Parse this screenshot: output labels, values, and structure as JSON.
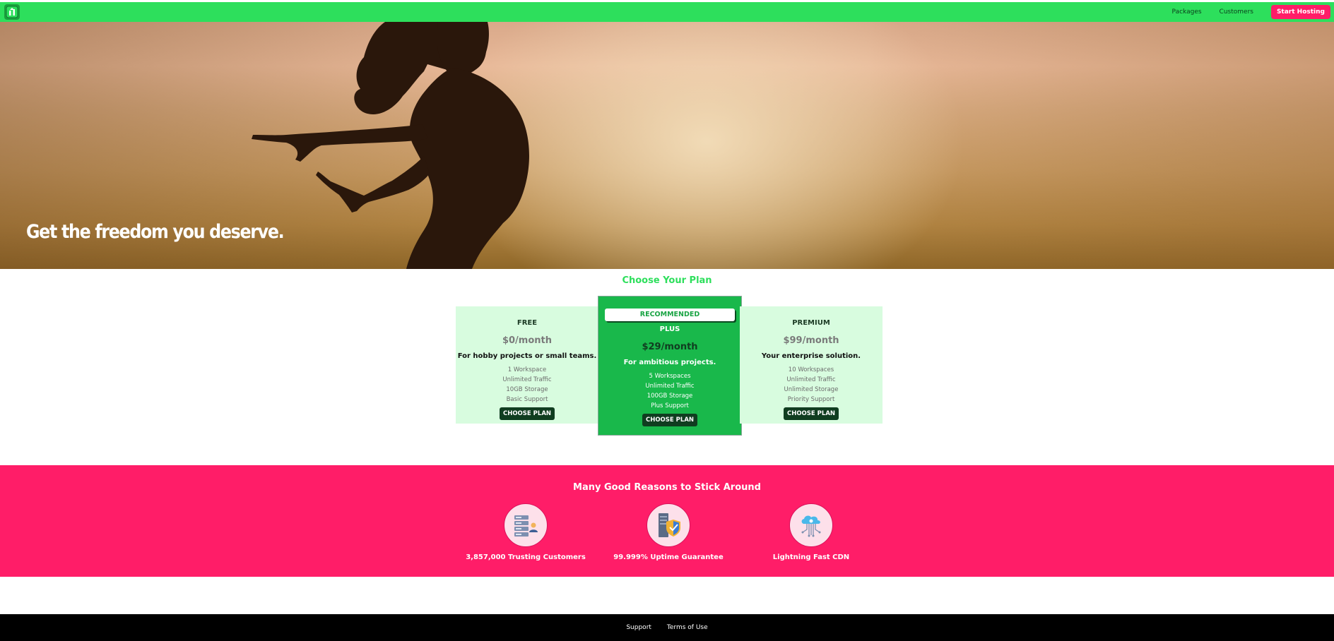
{
  "header": {
    "logo_icon": "hosting-logo-icon",
    "nav": [
      {
        "label": "Packages"
      },
      {
        "label": "Customers"
      }
    ],
    "cta_label": "Start Hosting",
    "accent_color": "#2ddf5c",
    "cta_color": "#ff1d68"
  },
  "hero": {
    "title": "Get the freedom you deserve."
  },
  "plans": {
    "title": "Choose Your Plan",
    "items": [
      {
        "name": "FREE",
        "price": "$0/month",
        "description": "For hobby projects or small teams.",
        "features": [
          "1 Workspace",
          "Unlimited Traffic",
          "10GB Storage",
          "Basic Support"
        ],
        "button": "CHOOSE PLAN"
      },
      {
        "badge": "RECOMMENDED",
        "name": "PLUS",
        "price": "$29/month",
        "description": "For ambitious projects.",
        "features": [
          "5 Workspaces",
          "Unlimited Traffic",
          "100GB Storage",
          "Plus Support"
        ],
        "button": "CHOOSE PLAN"
      },
      {
        "name": "PREMIUM",
        "price": "$99/month",
        "description": "Your enterprise solution.",
        "features": [
          "10 Workspaces",
          "Unlimited Traffic",
          "Unlimited Storage",
          "Priority Support"
        ],
        "button": "CHOOSE PLAN"
      }
    ]
  },
  "reasons": {
    "title": "Many Good Reasons to Stick Around",
    "items": [
      {
        "icon": "customers-server-icon",
        "label": "3,857,000 Trusting Customers"
      },
      {
        "icon": "shield-server-icon",
        "label": "99.999% Uptime Guarantee"
      },
      {
        "icon": "cloud-network-icon",
        "label": "Lightning Fast CDN"
      }
    ]
  },
  "footer": {
    "links": [
      {
        "label": "Support"
      },
      {
        "label": "Terms of Use"
      }
    ]
  }
}
